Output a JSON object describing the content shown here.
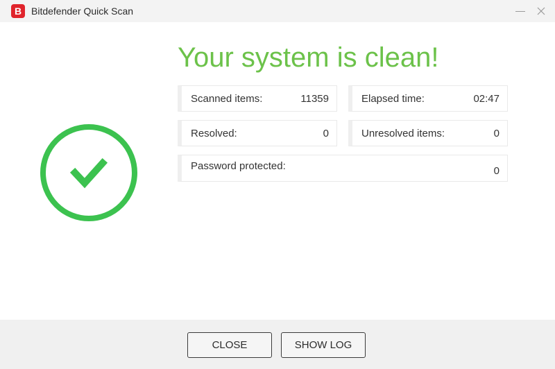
{
  "window": {
    "title": "Bitdefender Quick Scan",
    "logo_letter": "B",
    "brand_color": "#e0242c",
    "icons": [
      "minimize-icon",
      "close-icon"
    ]
  },
  "result": {
    "headline": "Your system is clean!",
    "headline_color": "#6cc24a",
    "status_icon": "check-circle-icon",
    "status_color": "#3cc24f"
  },
  "stats": {
    "scanned": {
      "label": "Scanned items:",
      "value": "11359"
    },
    "elapsed": {
      "label": "Elapsed time:",
      "value": "02:47"
    },
    "resolved": {
      "label": "Resolved:",
      "value": "0"
    },
    "unresolved": {
      "label": "Unresolved items:",
      "value": "0"
    },
    "password": {
      "label": "Password protected:",
      "value": "0"
    }
  },
  "footer": {
    "close_label": "CLOSE",
    "show_log_label": "SHOW LOG"
  }
}
